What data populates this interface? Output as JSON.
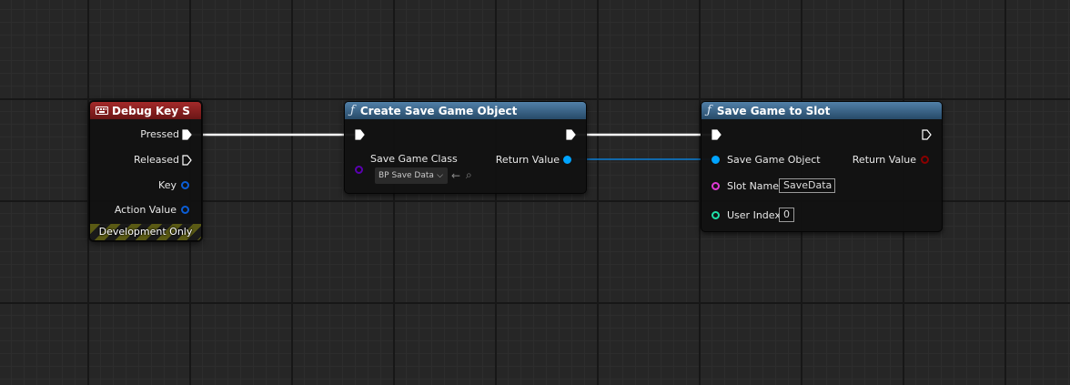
{
  "nodes": {
    "debug_key": {
      "title": "Debug Key S",
      "outputs": {
        "pressed": "Pressed",
        "released": "Released",
        "key": "Key",
        "action_value": "Action Value"
      },
      "footer": "Development Only",
      "header_color": "#8e2222"
    },
    "create_save": {
      "title": "Create Save Game Object",
      "icon": "function-icon",
      "inputs": {
        "save_game_class": "Save Game Class"
      },
      "class_value": "BP Save Data",
      "outputs": {
        "return_value": "Return Value"
      },
      "header_color": "#3e6a8e"
    },
    "save_slot": {
      "title": "Save Game to Slot",
      "icon": "function-icon",
      "inputs": {
        "save_game_object": "Save Game Object",
        "slot_name": "Slot Name",
        "user_index": "User Index"
      },
      "slot_name_value": "SaveData",
      "user_index_value": "0",
      "outputs": {
        "return_value": "Return Value"
      },
      "header_color": "#3e6a8e"
    }
  },
  "pin_colors": {
    "exec": "#ffffff",
    "struct": "#0b5ed7",
    "object": "#00a4ff",
    "class": "#5a00b0",
    "string": "#e03ad6",
    "integer": "#1fe0a8",
    "bool": "#8b0000"
  }
}
